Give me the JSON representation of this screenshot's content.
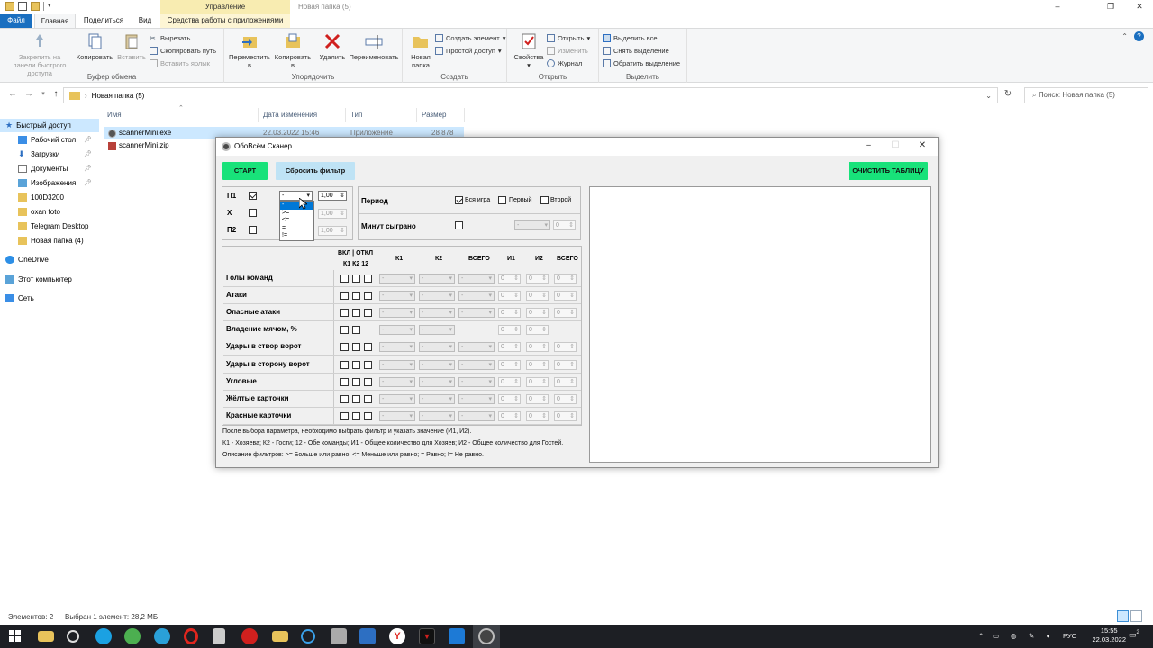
{
  "explorer": {
    "title": "Новая папка (5)",
    "manage_tab": "Управление",
    "tabs": [
      "Файл",
      "Главная",
      "Поделиться",
      "Вид",
      "Средства работы с приложениями"
    ],
    "ribbon": {
      "clipboard": {
        "pin": "Закрепить на панели быстрого доступа",
        "copy": "Копировать",
        "paste": "Вставить",
        "cut": "Вырезать",
        "copy_path": "Скопировать путь",
        "paste_shortcut": "Вставить ярлык",
        "label": "Буфер обмена"
      },
      "organize": {
        "move": "Переместить в",
        "copyto": "Копировать в",
        "delete": "Удалить",
        "rename": "Переименовать",
        "label": "Упорядочить"
      },
      "create": {
        "new_folder": "Новая папка",
        "new_item": "Создать элемент",
        "easy_access": "Простой доступ",
        "label": "Создать"
      },
      "open": {
        "properties": "Свойства",
        "open": "Открыть",
        "edit": "Изменить",
        "history": "Журнал",
        "label": "Открыть"
      },
      "select": {
        "all": "Выделить все",
        "none": "Снять выделение",
        "invert": "Обратить выделение",
        "label": "Выделить"
      }
    },
    "address": "Новая папка (5)",
    "search_placeholder": "Поиск: Новая папка (5)",
    "columns": [
      "Имя",
      "Дата изменения",
      "Тип",
      "Размер"
    ],
    "files": [
      {
        "name": "scannerMini.exe",
        "date": "22.03.2022 15:46",
        "type": "Приложение",
        "size": "28 878 КБ"
      },
      {
        "name": "scannerMini.zip",
        "date": "",
        "type": "",
        "size": ""
      }
    ],
    "nav": [
      {
        "label": "Быстрый доступ",
        "pinned": false
      },
      {
        "label": "Рабочий стол",
        "pinned": true
      },
      {
        "label": "Загрузки",
        "pinned": true
      },
      {
        "label": "Документы",
        "pinned": true
      },
      {
        "label": "Изображения",
        "pinned": true
      },
      {
        "label": "100D3200",
        "pinned": false
      },
      {
        "label": "oxan foto",
        "pinned": false
      },
      {
        "label": "Telegram Desktop",
        "pinned": false
      },
      {
        "label": "Новая папка (4)",
        "pinned": false
      },
      {
        "label": "OneDrive",
        "pinned": false
      },
      {
        "label": "Этот компьютер",
        "pinned": false
      },
      {
        "label": "Сеть",
        "pinned": false
      }
    ],
    "status_count": "Элементов: 2",
    "status_selected": "Выбран 1 элемент: 28,2 МБ"
  },
  "taskbar": {
    "lang": "РУС",
    "time": "15:55",
    "date": "22.03.2022",
    "notif_count": "2"
  },
  "app": {
    "title": "ОбоВсём Сканер",
    "start": "СТАРТ",
    "reset": "Сбросить фильтр",
    "clear": "ОЧИСТИТЬ ТАБЛИЦУ",
    "outcomes": [
      {
        "label": "П1",
        "checked": true,
        "op": "-",
        "value": "1,00"
      },
      {
        "label": "Х",
        "checked": false,
        "op": "",
        "value": "1,00"
      },
      {
        "label": "П2",
        "checked": false,
        "op": "",
        "value": "1,00"
      }
    ],
    "dropdown_options": [
      "-",
      ">=",
      "<=",
      "=",
      "!="
    ],
    "period_label": "Период",
    "period_opts": [
      {
        "label": "Вся игра",
        "checked": true
      },
      {
        "label": "Первый",
        "checked": false
      },
      {
        "label": "Второй",
        "checked": false
      }
    ],
    "minutes_label": "Минут сыграно",
    "minutes_combo": "-",
    "minutes_value": "0",
    "grid_headers": {
      "onoff": "ВКЛ | ОТКЛ",
      "sub": "К1 К2 12",
      "k1": "К1",
      "k2": "К2",
      "total": "ВСЕГО",
      "i1": "И1",
      "i2": "И2",
      "total2": "ВСЕГО"
    },
    "rows": [
      {
        "label": "Голы команд",
        "checks": 3,
        "combos": 3,
        "spins": 3
      },
      {
        "label": "Атаки",
        "checks": 3,
        "combos": 3,
        "spins": 3
      },
      {
        "label": "Опасные атаки",
        "checks": 3,
        "combos": 3,
        "spins": 3
      },
      {
        "label": "Владение мячом, %",
        "checks": 2,
        "combos": 2,
        "spins": 2
      },
      {
        "label": "Удары в створ ворот",
        "checks": 3,
        "combos": 3,
        "spins": 3
      },
      {
        "label": "Удары в сторону ворот",
        "checks": 3,
        "combos": 3,
        "spins": 3
      },
      {
        "label": "Угловые",
        "checks": 3,
        "combos": 3,
        "spins": 3
      },
      {
        "label": "Жёлтые карточки",
        "checks": 3,
        "combos": 3,
        "spins": 3
      },
      {
        "label": "Красные карточки",
        "checks": 3,
        "combos": 3,
        "spins": 3
      }
    ],
    "combo_placeholder": "-",
    "spin_default": "0",
    "notes": [
      "После выбора параметра, необходимо выбрать фильтр и указать значение (И1, И2).",
      "К1 - Хозяева; К2 - Гости; 12 - Обе команды; И1 - Общее количество для Хозяев; И2 - Общее количество для Гостей.",
      "Описание фильтров: >= Больше или равно; <= Меньше или равно; = Равно; != Не равно."
    ]
  }
}
